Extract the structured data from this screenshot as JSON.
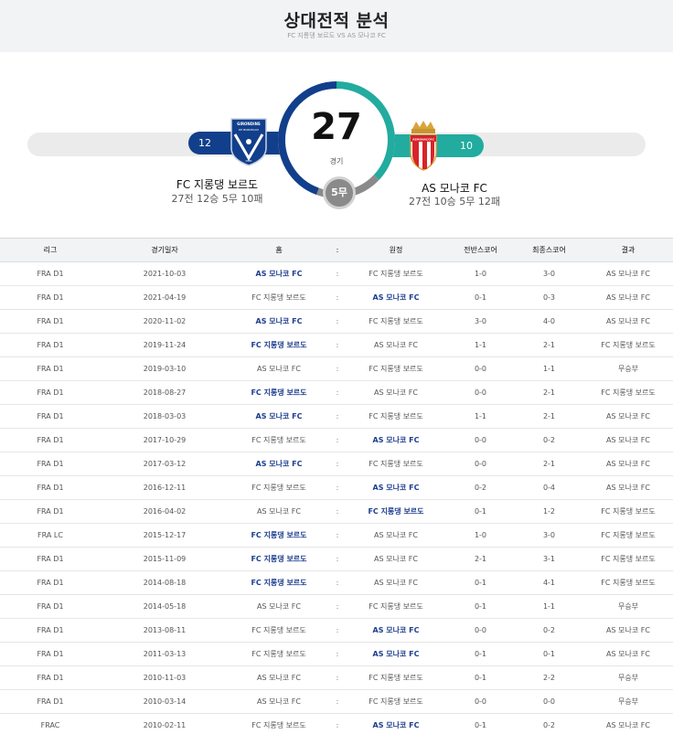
{
  "header": {
    "title": "상대전적 분석",
    "subtitle": "FC 지롱댕 보르도 VS AS 모나코 FC"
  },
  "summary": {
    "total": "27",
    "total_label": "경기",
    "draws": "5무",
    "home": {
      "name": "FC 지롱댕 보르도",
      "record": "27전 12승 5무 10패",
      "wins": "12",
      "color": "#123f8b"
    },
    "away": {
      "name": "AS 모나코 FC",
      "record": "27전 10승 5무 12패",
      "wins": "10",
      "color": "#22ab9f"
    },
    "logos": {
      "home": {
        "icon": "girondins-bordeaux-crest",
        "top_text": "GIRONDINS",
        "mid_text": "DE BORDEAUX",
        "year": "1881"
      },
      "away": {
        "icon": "as-monaco-crest",
        "banner_text": "ASMONACOFC"
      }
    }
  },
  "table": {
    "headers": [
      "리그",
      "경기일자",
      "홈",
      ":",
      "원정",
      "전반스코어",
      "최종스코어",
      "결과"
    ],
    "rows": [
      {
        "league": "FRA D1",
        "date": "2021-10-03",
        "home": "AS 모나코 FC",
        "away": "FC 지롱댕 보르도",
        "half": "1-0",
        "final": "3-0",
        "result": "AS 모나코 FC",
        "winner": "home"
      },
      {
        "league": "FRA D1",
        "date": "2021-04-19",
        "home": "FC 지롱댕 보르도",
        "away": "AS 모나코 FC",
        "half": "0-1",
        "final": "0-3",
        "result": "AS 모나코 FC",
        "winner": "away"
      },
      {
        "league": "FRA D1",
        "date": "2020-11-02",
        "home": "AS 모나코 FC",
        "away": "FC 지롱댕 보르도",
        "half": "3-0",
        "final": "4-0",
        "result": "AS 모나코 FC",
        "winner": "home"
      },
      {
        "league": "FRA D1",
        "date": "2019-11-24",
        "home": "FC 지롱댕 보르도",
        "away": "AS 모나코 FC",
        "half": "1-1",
        "final": "2-1",
        "result": "FC 지롱댕 보르도",
        "winner": "home"
      },
      {
        "league": "FRA D1",
        "date": "2019-03-10",
        "home": "AS 모나코 FC",
        "away": "FC 지롱댕 보르도",
        "half": "0-0",
        "final": "1-1",
        "result": "무승부",
        "winner": "none"
      },
      {
        "league": "FRA D1",
        "date": "2018-08-27",
        "home": "FC 지롱댕 보르도",
        "away": "AS 모나코 FC",
        "half": "0-0",
        "final": "2-1",
        "result": "FC 지롱댕 보르도",
        "winner": "home"
      },
      {
        "league": "FRA D1",
        "date": "2018-03-03",
        "home": "AS 모나코 FC",
        "away": "FC 지롱댕 보르도",
        "half": "1-1",
        "final": "2-1",
        "result": "AS 모나코 FC",
        "winner": "home"
      },
      {
        "league": "FRA D1",
        "date": "2017-10-29",
        "home": "FC 지롱댕 보르도",
        "away": "AS 모나코 FC",
        "half": "0-0",
        "final": "0-2",
        "result": "AS 모나코 FC",
        "winner": "away"
      },
      {
        "league": "FRA D1",
        "date": "2017-03-12",
        "home": "AS 모나코 FC",
        "away": "FC 지롱댕 보르도",
        "half": "0-0",
        "final": "2-1",
        "result": "AS 모나코 FC",
        "winner": "home"
      },
      {
        "league": "FRA D1",
        "date": "2016-12-11",
        "home": "FC 지롱댕 보르도",
        "away": "AS 모나코 FC",
        "half": "0-2",
        "final": "0-4",
        "result": "AS 모나코 FC",
        "winner": "away"
      },
      {
        "league": "FRA D1",
        "date": "2016-04-02",
        "home": "AS 모나코 FC",
        "away": "FC 지롱댕 보르도",
        "half": "0-1",
        "final": "1-2",
        "result": "FC 지롱댕 보르도",
        "winner": "away"
      },
      {
        "league": "FRA LC",
        "date": "2015-12-17",
        "home": "FC 지롱댕 보르도",
        "away": "AS 모나코 FC",
        "half": "1-0",
        "final": "3-0",
        "result": "FC 지롱댕 보르도",
        "winner": "home"
      },
      {
        "league": "FRA D1",
        "date": "2015-11-09",
        "home": "FC 지롱댕 보르도",
        "away": "AS 모나코 FC",
        "half": "2-1",
        "final": "3-1",
        "result": "FC 지롱댕 보르도",
        "winner": "home"
      },
      {
        "league": "FRA D1",
        "date": "2014-08-18",
        "home": "FC 지롱댕 보르도",
        "away": "AS 모나코 FC",
        "half": "0-1",
        "final": "4-1",
        "result": "FC 지롱댕 보르도",
        "winner": "home"
      },
      {
        "league": "FRA D1",
        "date": "2014-05-18",
        "home": "AS 모나코 FC",
        "away": "FC 지롱댕 보르도",
        "half": "0-1",
        "final": "1-1",
        "result": "무승부",
        "winner": "none"
      },
      {
        "league": "FRA D1",
        "date": "2013-08-11",
        "home": "FC 지롱댕 보르도",
        "away": "AS 모나코 FC",
        "half": "0-0",
        "final": "0-2",
        "result": "AS 모나코 FC",
        "winner": "away"
      },
      {
        "league": "FRA D1",
        "date": "2011-03-13",
        "home": "FC 지롱댕 보르도",
        "away": "AS 모나코 FC",
        "half": "0-1",
        "final": "0-1",
        "result": "AS 모나코 FC",
        "winner": "away"
      },
      {
        "league": "FRA D1",
        "date": "2010-11-03",
        "home": "AS 모나코 FC",
        "away": "FC 지롱댕 보르도",
        "half": "0-1",
        "final": "2-2",
        "result": "무승부",
        "winner": "none"
      },
      {
        "league": "FRA D1",
        "date": "2010-03-14",
        "home": "AS 모나코 FC",
        "away": "FC 지롱댕 보르도",
        "half": "0-0",
        "final": "0-0",
        "result": "무승부",
        "winner": "none"
      },
      {
        "league": "FRAC",
        "date": "2010-02-11",
        "home": "FC 지롱댕 보르도",
        "away": "AS 모나코 FC",
        "half": "0-1",
        "final": "0-2",
        "result": "AS 모나코 FC",
        "winner": "away"
      }
    ]
  }
}
